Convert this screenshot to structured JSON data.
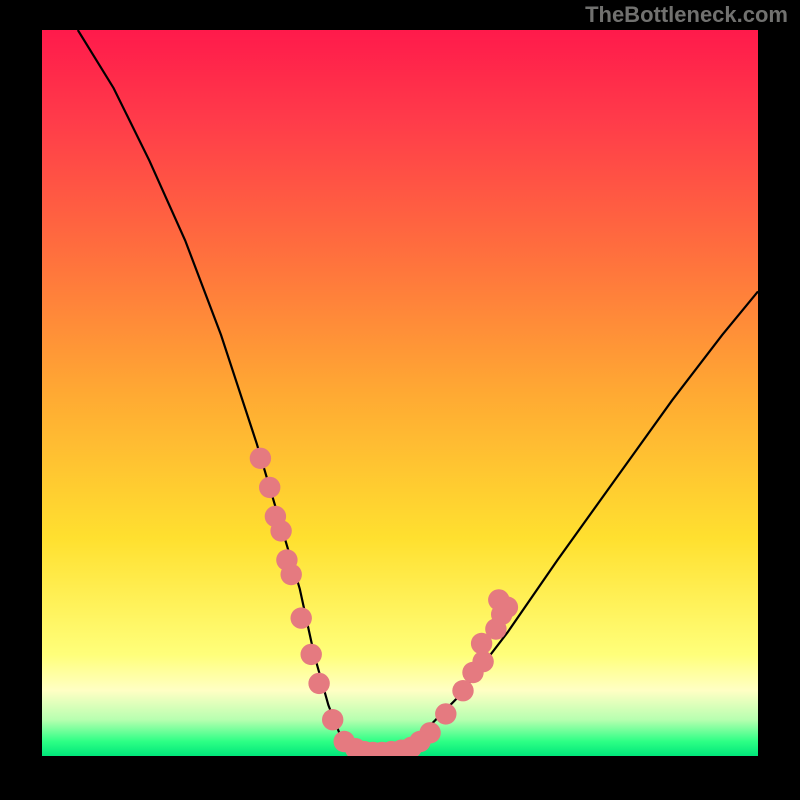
{
  "watermark": "TheBottleneck.com",
  "chart_data": {
    "type": "line",
    "title": "",
    "xlabel": "",
    "ylabel": "",
    "xlim": [
      0,
      100
    ],
    "ylim": [
      0,
      100
    ],
    "grid": false,
    "legend": false,
    "description": "Asymmetric V-shaped curve over a vertical rainbow gradient (red at top, green at bottom). The curve's minimum is the bottleneck-balanced region (near green). Pink markers cluster along the curve in the lower band (roughly y ≤ 30).",
    "series": [
      {
        "name": "curve",
        "color": "#000000",
        "x": [
          5,
          10,
          15,
          20,
          25,
          30,
          33,
          36,
          38,
          40,
          42,
          45,
          48,
          52,
          58,
          65,
          72,
          80,
          88,
          95,
          100
        ],
        "y": [
          100,
          92,
          82,
          71,
          58,
          43,
          33,
          23,
          14,
          7,
          2,
          0,
          0,
          2,
          8,
          17,
          27,
          38,
          49,
          58,
          64
        ]
      }
    ],
    "markers": {
      "color": "#e57a80",
      "radius": 1.5,
      "points": [
        {
          "x": 30.5,
          "y": 41
        },
        {
          "x": 31.8,
          "y": 37
        },
        {
          "x": 32.6,
          "y": 33
        },
        {
          "x": 33.4,
          "y": 31
        },
        {
          "x": 34.2,
          "y": 27
        },
        {
          "x": 34.8,
          "y": 25
        },
        {
          "x": 36.2,
          "y": 19
        },
        {
          "x": 37.6,
          "y": 14
        },
        {
          "x": 38.7,
          "y": 10
        },
        {
          "x": 40.6,
          "y": 5
        },
        {
          "x": 42.2,
          "y": 2
        },
        {
          "x": 43.8,
          "y": 1
        },
        {
          "x": 45.0,
          "y": 0.6
        },
        {
          "x": 46.2,
          "y": 0.5
        },
        {
          "x": 47.5,
          "y": 0.5
        },
        {
          "x": 48.8,
          "y": 0.6
        },
        {
          "x": 50.2,
          "y": 0.8
        },
        {
          "x": 51.6,
          "y": 1.2
        },
        {
          "x": 52.8,
          "y": 2
        },
        {
          "x": 54.2,
          "y": 3.2
        },
        {
          "x": 56.4,
          "y": 5.8
        },
        {
          "x": 58.8,
          "y": 9
        },
        {
          "x": 60.2,
          "y": 11.5
        },
        {
          "x": 61.4,
          "y": 15.5
        },
        {
          "x": 61.6,
          "y": 13
        },
        {
          "x": 63.4,
          "y": 17.5
        },
        {
          "x": 63.8,
          "y": 21.5
        },
        {
          "x": 64.2,
          "y": 19.5
        },
        {
          "x": 65.0,
          "y": 20.5
        }
      ]
    }
  }
}
